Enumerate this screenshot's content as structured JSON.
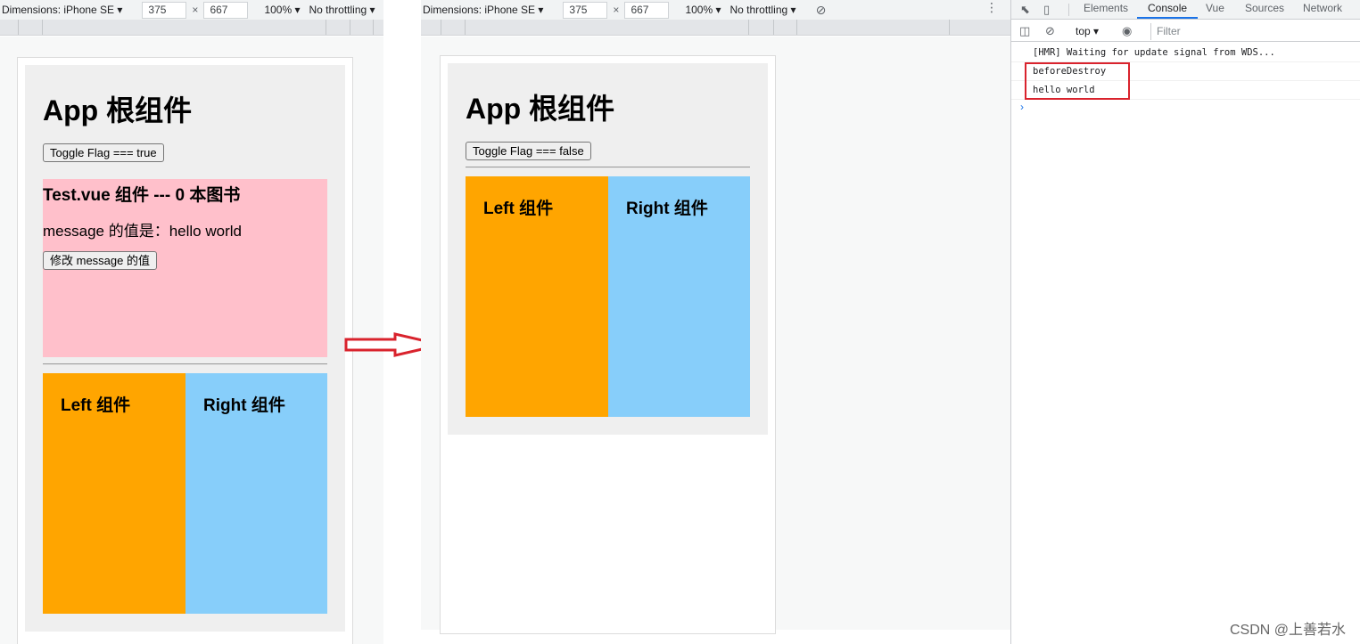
{
  "device_toolbar": {
    "dimensions": "Dimensions: iPhone SE ▾",
    "width": "375",
    "times": "×",
    "height": "667",
    "zoom": "100% ▾",
    "throttling": "No throttling ▾"
  },
  "before": {
    "app_title": "App 根组件",
    "toggle_label": "Toggle Flag === true",
    "test_title": "Test.vue 组件 --- 0 本图书",
    "message_text": "message 的值是：hello world",
    "modify_label": "修改 message 的值",
    "left_title": "Left 组件",
    "right_title": "Right 组件"
  },
  "after": {
    "app_title": "App 根组件",
    "toggle_label": "Toggle Flag === false",
    "left_title": "Left 组件",
    "right_title": "Right 组件"
  },
  "devtools": {
    "tabs": [
      "Elements",
      "Console",
      "Vue",
      "Sources",
      "Network"
    ],
    "active_tab": "Console",
    "context": "top ▾",
    "filter_placeholder": "Filter",
    "logs": [
      "[HMR] Waiting for update signal from WDS...",
      "beforeDestroy",
      "hello world"
    ],
    "prompt": "›"
  },
  "colors": {
    "pink": "#ffc0cb",
    "orange": "#ffa500",
    "lightblue": "#87cefa",
    "highlight_red": "#d9232d",
    "active_tab_blue": "#1a73e8"
  },
  "watermark": "CSDN @上善若水"
}
